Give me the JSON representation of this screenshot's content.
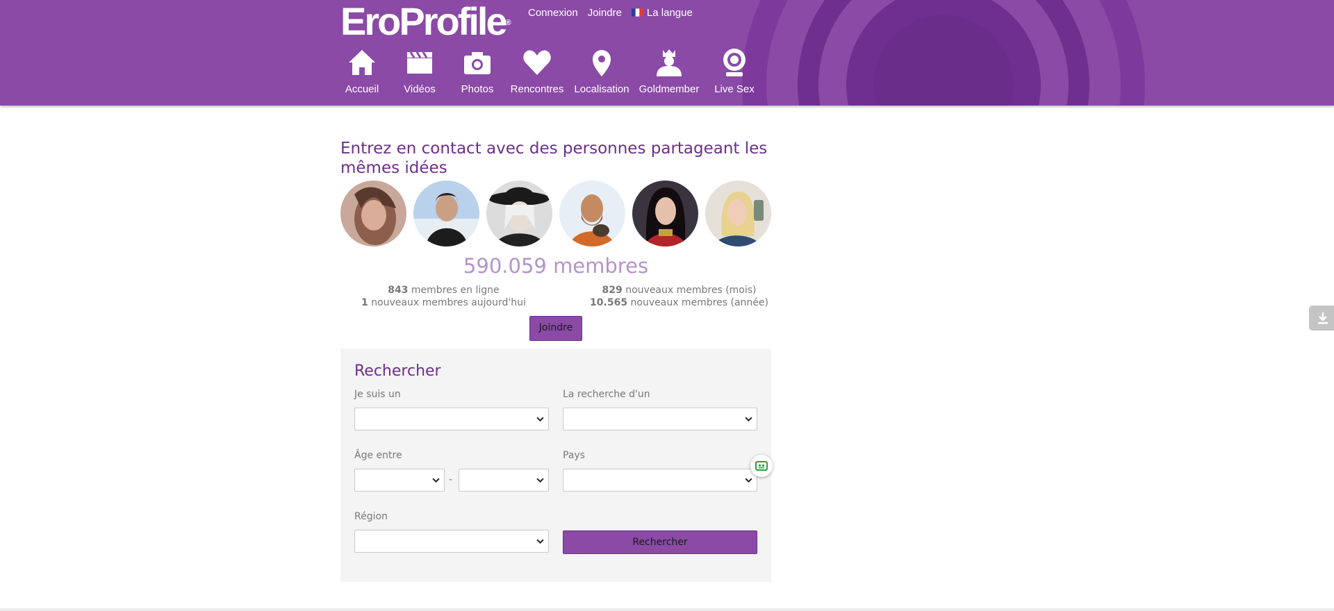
{
  "brand": {
    "logo_text": "EroProfile",
    "registered": "®",
    "primary": "#8a4aa6",
    "dark": "#6b2f8c"
  },
  "toplinks": {
    "login": "Connexion",
    "join": "Joindre",
    "language": "La langue",
    "language_flag": "fr-flag-icon"
  },
  "nav": [
    {
      "label": "Accueil",
      "icon": "home-icon"
    },
    {
      "label": "Vidéos",
      "icon": "clapperboard-icon"
    },
    {
      "label": "Photos",
      "icon": "camera-icon"
    },
    {
      "label": "Rencontres",
      "icon": "heart-icon"
    },
    {
      "label": "Localisation",
      "icon": "map-pin-icon"
    },
    {
      "label": "Goldmember",
      "icon": "crown-person-icon"
    },
    {
      "label": "Live Sex",
      "icon": "webcam-icon"
    }
  ],
  "main": {
    "title": "Entrez en contact avec des personnes partageant les mêmes idées",
    "members_total": "590.059 membres",
    "stats": {
      "online_count": "843",
      "online_label": "membres en ligne",
      "today_count": "1",
      "today_label": "nouveaux membres aujourd'hui",
      "month_count": "829",
      "month_label": "nouveaux membres (mois)",
      "year_count": "10.565",
      "year_label": "nouveaux membres (année)"
    },
    "join_button": "Joindre"
  },
  "search": {
    "title": "Rechercher",
    "iam_label": "Je suis un",
    "seeking_label": "La recherche d'un",
    "age_label": "Âge entre",
    "age_separator": "-",
    "country_label": "Pays",
    "region_label": "Région",
    "submit": "Rechercher"
  }
}
